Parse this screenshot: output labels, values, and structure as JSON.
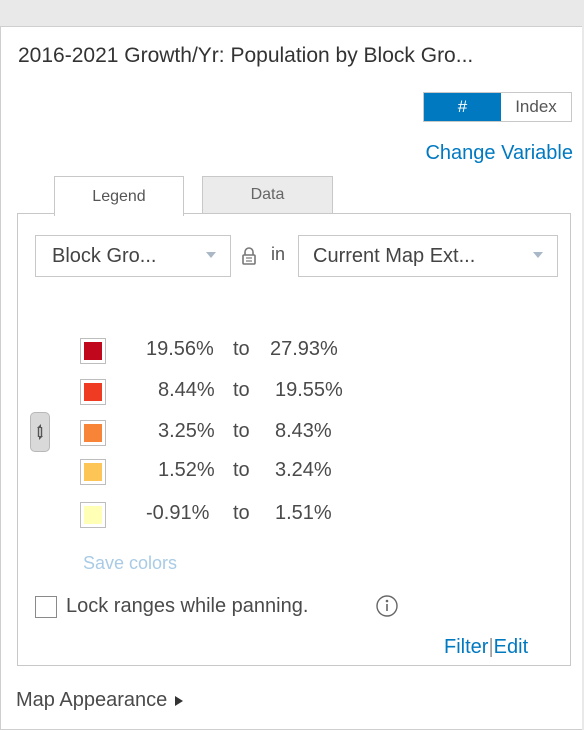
{
  "panel": {
    "title": "2016-2021 Growth/Yr: Population by Block Gro...",
    "toggle": {
      "hash_label": "#",
      "index_label": "Index"
    },
    "change_variable": "Change Variable"
  },
  "tabs": [
    {
      "label": "Legend",
      "active": true
    },
    {
      "label": "Data",
      "active": false
    }
  ],
  "legend": {
    "geography_dropdown": "Block Gro...",
    "in_text": "in",
    "extent_dropdown": "Current Map Ext...",
    "ranges": [
      {
        "from": "19.56%",
        "to_word": "to",
        "to": "27.93%",
        "color": "#c0071c"
      },
      {
        "from": "8.44%",
        "to_word": "to",
        "to": "19.55%",
        "color": "#ef3b21"
      },
      {
        "from": "3.25%",
        "to_word": "to",
        "to": "8.43%",
        "color": "#f88537"
      },
      {
        "from": "1.52%",
        "to_word": "to",
        "to": "3.24%",
        "color": "#fdc555"
      },
      {
        "from": "-0.91%",
        "to_word": "to",
        "to": "1.51%",
        "color": "#ffffb5"
      }
    ],
    "save_colors": "Save colors",
    "lock_ranges_label": "Lock ranges while panning.",
    "lock_ranges_checked": false,
    "filter_label": "Filter",
    "separator": "|",
    "edit_label": "Edit"
  },
  "map_appearance": "Map Appearance",
  "colors": {
    "accent": "#0079c1"
  }
}
